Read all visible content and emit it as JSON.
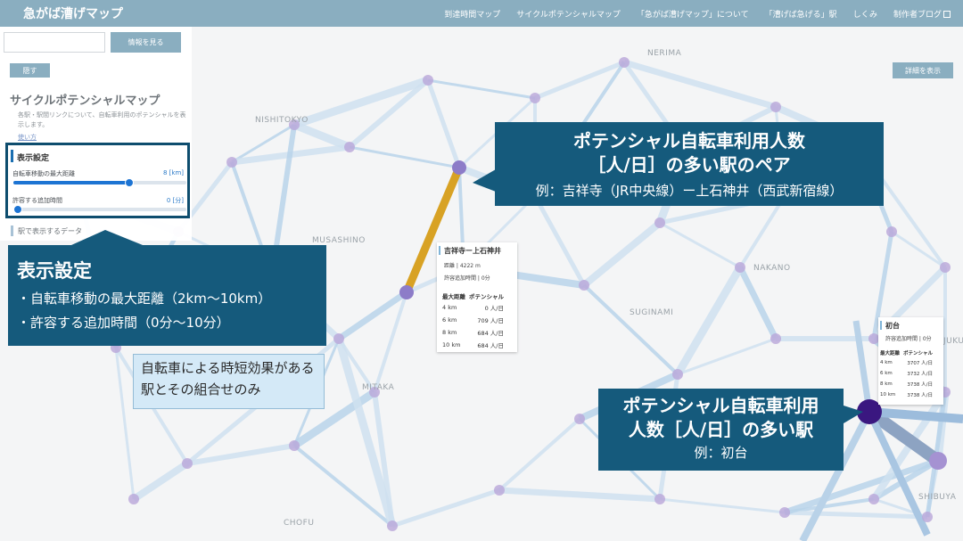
{
  "header": {
    "app_title": "急がば漕げマップ",
    "nav": [
      {
        "label": "到達時間マップ"
      },
      {
        "label": "サイクルポテンシャルマップ"
      },
      {
        "label": "「急がば漕げマップ」について"
      },
      {
        "label": "「漕げば急げる」駅"
      },
      {
        "label": "しくみ"
      },
      {
        "label": "制作者ブログ"
      }
    ]
  },
  "side_panel": {
    "info_button": "情報を見る",
    "hide_button": "隠す",
    "title": "サイクルポテンシャルマップ",
    "description": "各駅・駅間リンクについて、自転車利用のポテンシャルを表示します。",
    "more_link": "使い方",
    "settings": {
      "title": "表示設定",
      "slider1_label": "自転車移動の最大距離",
      "slider1_value": "8 [km]",
      "slider1_fraction": 0.67,
      "slider2_label": "許容する追加時間",
      "slider2_value": "0 [分]",
      "slider2_fraction": 0.0
    },
    "data_heading": "駅で表示するデータ"
  },
  "detail_button": "詳細を表示",
  "map_labels": [
    "NERIMA",
    "NISHITOKYO",
    "MUSASHINO",
    "SUGINAMI",
    "MITAKA",
    "CHOFU",
    "NAKANO",
    "JUKU",
    "SHIBUYA"
  ],
  "callouts": {
    "pair": {
      "line1": "ポテンシャル自転車利用人数",
      "line2": "［人/日］の多い駅のペア",
      "example": "例：吉祥寺（JR中央線）ー上石神井（西武新宿線）"
    },
    "settings": {
      "title": "表示設定",
      "item1": "・自転車移動の最大距離（2km〜10km）",
      "item2": "・許容する追加時間（0分〜10分）"
    },
    "note": "自転車による時短効果がある駅とその組合せのみ",
    "station": {
      "line1": "ポテンシャル自転車利用",
      "line2": "人数［人/日］の多い駅",
      "example": "例：初台"
    }
  },
  "popup_pair": {
    "title": "吉祥寺ー上石神井",
    "distance": "距離 | 4222 m",
    "allowed": "許容追加時間 | 0分",
    "col1": "最大距離",
    "col2": "ポテンシャル",
    "rows": [
      {
        "dist": "4 km",
        "val": "0 人/日"
      },
      {
        "dist": "6 km",
        "val": "709 人/日"
      },
      {
        "dist": "8 km",
        "val": "684 人/日"
      },
      {
        "dist": "10 km",
        "val": "684 人/日"
      }
    ]
  },
  "popup_station": {
    "title": "初台",
    "allowed": "許容追加時間 | 0分",
    "col1": "最大距離",
    "col2": "ポテンシャル",
    "rows": [
      {
        "dist": "4 km",
        "val": "3707 人/日"
      },
      {
        "dist": "6 km",
        "val": "3732 人/日"
      },
      {
        "dist": "8 km",
        "val": "3738 人/日"
      },
      {
        "dist": "10 km",
        "val": "3738 人/日"
      }
    ]
  },
  "colors": {
    "header": "#8aaec0",
    "callout": "#155a7c",
    "link_highlight": "#d8a224",
    "node": "#b9a6d9",
    "node_dark": "#3a1780"
  }
}
